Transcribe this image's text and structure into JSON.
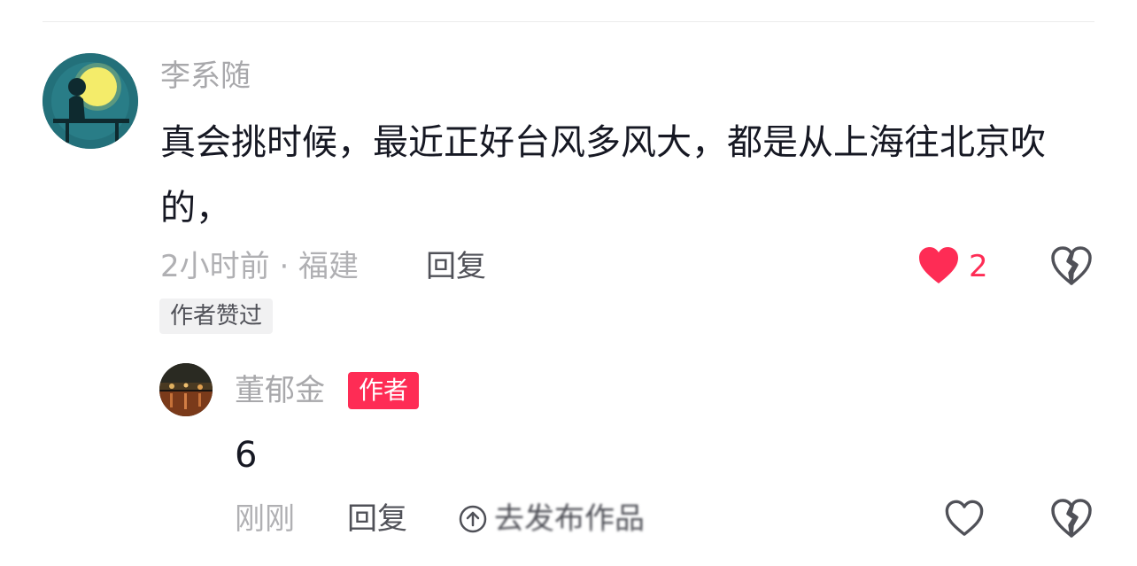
{
  "comment": {
    "username": "李系随",
    "text": "真会挑时候，最近正好台风多风大，都是从上海往北京吹的，",
    "time_location": "2小时前 · 福建",
    "reply_label": "回复",
    "like_count": "2",
    "liked": true,
    "author_liked_tag": "作者赞过"
  },
  "reply": {
    "username": "董郁金",
    "author_badge": "作者",
    "text": "6",
    "time": "刚刚",
    "reply_label": "回复",
    "liked": false
  },
  "overlay": {
    "publish_label": "去发布作品"
  },
  "colors": {
    "accent": "#fe2c55",
    "muted_text": "#a8a8ab",
    "body_text": "#161823"
  }
}
